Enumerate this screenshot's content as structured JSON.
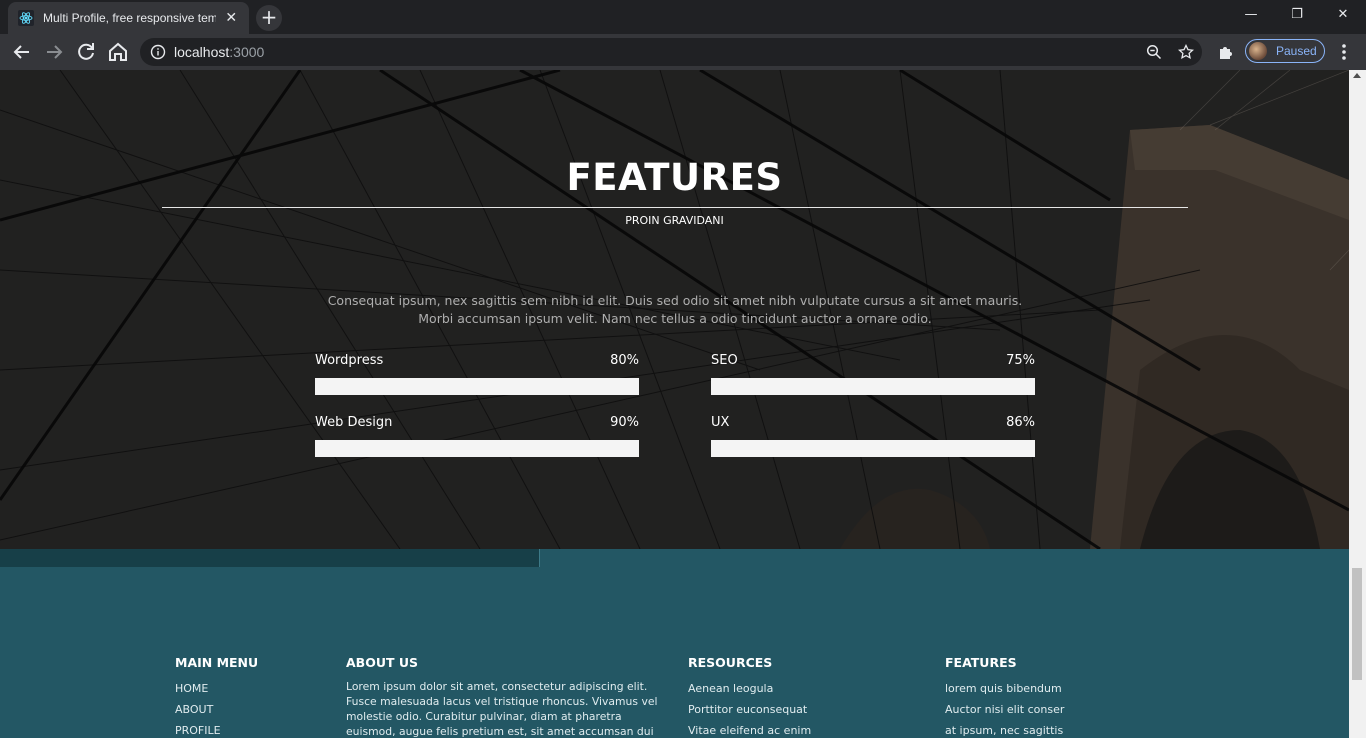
{
  "browser": {
    "tab_title": "Multi Profile, free responsive template",
    "tab_close": "✕",
    "new_tab": "+",
    "window_controls": {
      "minimize": "—",
      "restore": "❐",
      "close": "✕"
    },
    "url_host": "localhost",
    "url_port": ":3000",
    "profile_label": "Paused",
    "accent": "#8ab4f8"
  },
  "features": {
    "title": "FEATURES",
    "subtitle": "PROIN GRAVIDANI",
    "description": "Consequat ipsum, nex sagittis sem nibh id elit. Duis sed odio sit amet nibh vulputate cursus a sit amet mauris. Morbi accumsan ipsum velit. Nam nec tellus a odio tincidunt auctor a ornare odio.",
    "skills": [
      {
        "name": "Wordpress",
        "percent": "80%",
        "value": 80
      },
      {
        "name": "SEO",
        "percent": "75%",
        "value": 75
      },
      {
        "name": "Web Design",
        "percent": "90%",
        "value": 90
      },
      {
        "name": "UX",
        "percent": "86%",
        "value": 86
      }
    ]
  },
  "footer": {
    "main_menu": {
      "heading": "MAIN MENU",
      "links": [
        "HOME",
        "ABOUT",
        "PROFILE"
      ]
    },
    "about": {
      "heading": "ABOUT US",
      "text": "Lorem ipsum dolor sit amet, consectetur adipiscing elit. Fusce malesuada lacus vel tristique rhoncus. Vivamus vel molestie odio. Curabitur pulvinar, diam at pharetra euismod, augue felis pretium est, sit amet accumsan dui enim nec tortor. Cras"
    },
    "resources": {
      "heading": "RESOURCES",
      "links": [
        "Aenean leogula",
        "Porttitor euconsequat",
        "Vitae eleifend ac enim"
      ]
    },
    "features": {
      "heading": "FEATURES",
      "links": [
        "lorem quis bibendum",
        "Auctor nisi elit conser",
        "at ipsum, nec sagittis"
      ]
    },
    "color": "#235764"
  }
}
